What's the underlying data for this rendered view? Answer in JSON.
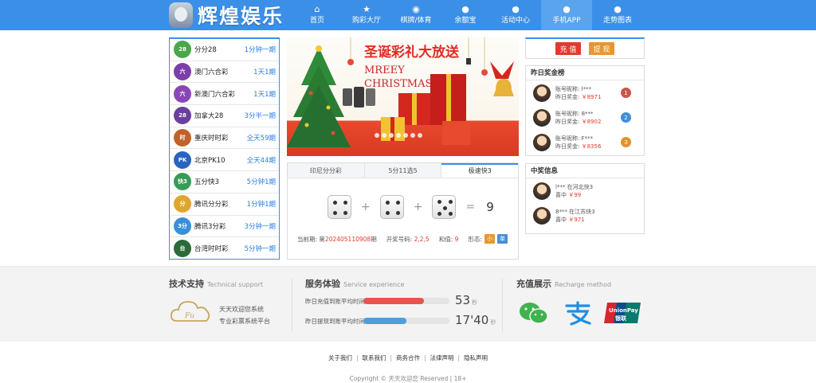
{
  "header": {
    "logo_text": "辉煌娱乐",
    "nav": [
      {
        "label": "首页",
        "icon": "home-icon",
        "glyph": "⌂"
      },
      {
        "label": "购彩大厅",
        "icon": "star-icon",
        "glyph": "★"
      },
      {
        "label": "棋牌/体育",
        "icon": "cart-icon",
        "glyph": "◉"
      },
      {
        "label": "余额宝",
        "icon": "money-bag-icon",
        "glyph": "●"
      },
      {
        "label": "活动中心",
        "icon": "money-bag-icon",
        "glyph": "●"
      },
      {
        "label": "手机APP",
        "icon": "money-bag-icon",
        "glyph": "●"
      },
      {
        "label": "走势图表",
        "icon": "money-bag-icon",
        "glyph": "●"
      }
    ],
    "active_index": 5
  },
  "games": [
    {
      "name": "分分28",
      "freq": "1分钟一期",
      "color": "#4aa84a",
      "tag": "28"
    },
    {
      "name": "澳门六合彩",
      "freq": "1天1期",
      "color": "#7b3fa8",
      "tag": "六"
    },
    {
      "name": "新澳门六合彩",
      "freq": "1天1期",
      "color": "#8a46b8",
      "tag": "六"
    },
    {
      "name": "加拿大28",
      "freq": "3分半一期",
      "color": "#6a3f9e",
      "tag": "28"
    },
    {
      "name": "重庆时时彩",
      "freq": "全天59期",
      "color": "#c0632a",
      "tag": "时"
    },
    {
      "name": "北京PK10",
      "freq": "全天44期",
      "color": "#2a64c0",
      "tag": "PK"
    },
    {
      "name": "五分快3",
      "freq": "5分钟1期",
      "color": "#3a9a58",
      "tag": "快3"
    },
    {
      "name": "腾讯分分彩",
      "freq": "1分钟1期",
      "color": "#e0a530",
      "tag": "分"
    },
    {
      "name": "腾讯3分彩",
      "freq": "3分钟一期",
      "color": "#3a8fd8",
      "tag": "3分"
    },
    {
      "name": "台湾时时彩",
      "freq": "5分钟一期",
      "color": "#2b6a3a",
      "tag": "台"
    }
  ],
  "banner": {
    "headline": "圣诞彩礼大放送",
    "sub1": "MREEY",
    "sub2": "CHRISTMAS"
  },
  "lottery": {
    "tabs": [
      "印尼分分彩",
      "5分11选5",
      "极速快3"
    ],
    "active_tab": 2,
    "dice": [
      4,
      4,
      5
    ],
    "plus": "+",
    "equals": "=",
    "sum": "9",
    "period_label": "当前期:",
    "period_prefix": "第",
    "period": "202405110908",
    "period_suffix": "期",
    "numbers_label": "开奖号码:",
    "numbers": "2,2,5",
    "sum_label": "和值:",
    "sum_value": "9",
    "shape_label": "形态:",
    "badge1": "小",
    "badge2": "单"
  },
  "actions": {
    "deposit": "充 值",
    "withdraw": "提 现"
  },
  "ranking": {
    "title": "昨日奖金榜",
    "nick_label": "账号昵称:",
    "prize_label": "昨日奖金:",
    "rows": [
      {
        "nick": "l***",
        "prize": "￥8971",
        "rank": "1",
        "color": "#c9574b"
      },
      {
        "nick": "8***",
        "prize": "￥8902",
        "rank": "2",
        "color": "#3f8ed8"
      },
      {
        "nick": "F***",
        "prize": "￥8356",
        "rank": "3",
        "color": "#e0922e"
      }
    ]
  },
  "winners": {
    "title": "中奖信息",
    "win_label": "喜中",
    "rows": [
      {
        "text": "l*** 在河北快3",
        "amount": "￥99"
      },
      {
        "text": "8*** 在江苏快3",
        "amount": "￥971"
      }
    ]
  },
  "footer": {
    "tech_title": "技术支持",
    "tech_en": "Technical support",
    "tech_line1": "天天欢迎您系统",
    "tech_line2": "专业彩票系统平台",
    "svc_title": "服务体验",
    "svc_en": "Service experience",
    "svc_rows": [
      {
        "label": "昨日充值到账平均时间",
        "value": "53",
        "unit": "秒",
        "fill": 0.7,
        "color": "#e8534e"
      },
      {
        "label": "昨日提现到账平均时间",
        "value": "17'40",
        "unit": "秒",
        "fill": 0.5,
        "color": "#4f9edb"
      }
    ],
    "pay_title": "充值展示",
    "pay_en": "Recharge method"
  },
  "links": [
    "关于我们",
    "联系我们",
    "商务合作",
    "法律声明",
    "隐私声明"
  ],
  "copyright": "Copyright © 天天欢迎您 Reserved | 18+"
}
